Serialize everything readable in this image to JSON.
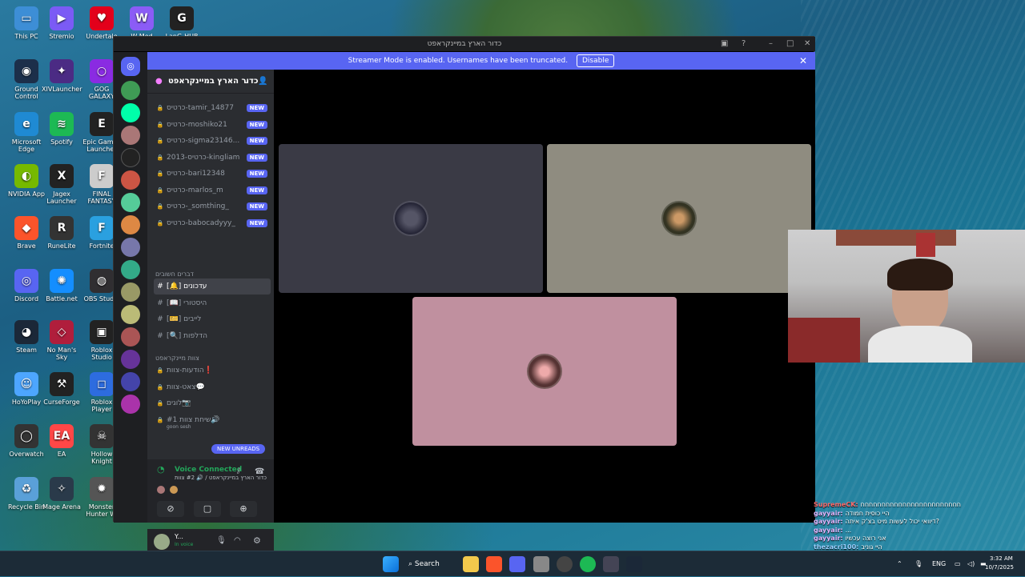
{
  "desktop": {
    "icons": [
      {
        "label": "This PC",
        "color": "#3d8ed6",
        "glyph": "▭"
      },
      {
        "label": "Stremio",
        "color": "#7b5bf5",
        "glyph": "▶"
      },
      {
        "label": "Undertale",
        "color": "#e3001b",
        "glyph": "♥"
      },
      {
        "label": "W-Mod",
        "color": "#8b5cf6",
        "glyph": "W"
      },
      {
        "label": "LanG-HUB",
        "color": "#222",
        "glyph": "G"
      },
      {
        "label": "Ground Control",
        "color": "#1c2f4a",
        "glyph": "◉"
      },
      {
        "label": "XIVLauncher",
        "color": "#4b2b84",
        "glyph": "✦"
      },
      {
        "label": "GOG GALAXY",
        "color": "#8a2be2",
        "glyph": "○"
      },
      {
        "label": "Microsoft Edge",
        "color": "#1f8ad3",
        "glyph": "e"
      },
      {
        "label": "Spotify",
        "color": "#1db954",
        "glyph": "≋"
      },
      {
        "label": "Epic Games Launcher",
        "color": "#222",
        "glyph": "E"
      },
      {
        "label": "NVIDIA App",
        "color": "#76b900",
        "glyph": "◐"
      },
      {
        "label": "Jagex Launcher",
        "color": "#222",
        "glyph": "X"
      },
      {
        "label": "FINAL FANTASY",
        "color": "#ccc",
        "glyph": "F"
      },
      {
        "label": "Brave",
        "color": "#fb542b",
        "glyph": "◆"
      },
      {
        "label": "RuneLite",
        "color": "#333",
        "glyph": "R"
      },
      {
        "label": "Fortnite",
        "color": "#2aa0e0",
        "glyph": "F"
      },
      {
        "label": "Discord",
        "color": "#5865f2",
        "glyph": "◎"
      },
      {
        "label": "Battle.net",
        "color": "#148eff",
        "glyph": "✺"
      },
      {
        "label": "OBS Studio",
        "color": "#302e31",
        "glyph": "◍"
      },
      {
        "label": "Steam",
        "color": "#1b2838",
        "glyph": "◕"
      },
      {
        "label": "No Man's Sky",
        "color": "#b01e3c",
        "glyph": "◇"
      },
      {
        "label": "Roblox Studio",
        "color": "#222",
        "glyph": "▣"
      },
      {
        "label": "HoYoPlay",
        "color": "#4da6ff",
        "glyph": "☺"
      },
      {
        "label": "CurseForge",
        "color": "#222",
        "glyph": "⚒"
      },
      {
        "label": "Roblox Player",
        "color": "#2d6cdf",
        "glyph": "◻"
      },
      {
        "label": "Overwatch",
        "color": "#333",
        "glyph": "◯"
      },
      {
        "label": "EA",
        "color": "#ff4747",
        "glyph": "EA"
      },
      {
        "label": "Hollow Knight",
        "color": "#333",
        "glyph": "☠"
      },
      {
        "label": "Recycle Bin",
        "color": "#5aa0d8",
        "glyph": "♻"
      },
      {
        "label": "Mage Arena",
        "color": "#2a3a4a",
        "glyph": "✧"
      },
      {
        "label": "Monster Hunter W.",
        "color": "#555",
        "glyph": "✹"
      }
    ]
  },
  "window": {
    "title": "כדור הארץ במיינקראפט",
    "help_icon": "help-icon"
  },
  "banner": {
    "text": "Streamer Mode is enabled. Usernames have been truncated.",
    "button": "Disable",
    "close": "✕"
  },
  "server": {
    "name": "כדור הארץ במיינקראפט"
  },
  "channels": [
    {
      "name": "כרטיס-tamir_14877",
      "new": "NEW"
    },
    {
      "name": "כרטיס-moshiko21",
      "new": "NEW"
    },
    {
      "name": "כרטיס-sigma23146...",
      "new": "NEW"
    },
    {
      "name": "2013-כרטיס-kingliam",
      "new": "NEW"
    },
    {
      "name": "כרטיס-bari12348",
      "new": "NEW"
    },
    {
      "name": "כרטיס-marlos_m",
      "new": "NEW"
    },
    {
      "name": "כרטיס-_somthing_",
      "new": "NEW"
    },
    {
      "name": "כרטיס-babocadyyy_",
      "new": "NEW"
    }
  ],
  "cat1": "דברים חשובים",
  "text_channels": [
    {
      "name": "[🔔] עדכונים"
    },
    {
      "name": "[📖] היסטורי"
    },
    {
      "name": "[🎫] לייבים"
    },
    {
      "name": "[🔍] הדלפות"
    }
  ],
  "cat2": "צוות מיינקראפט",
  "staff_channels": [
    {
      "name": "הודעות-צוות❗"
    },
    {
      "name": "צאט-צוות💬"
    },
    {
      "name": "לוגים📷"
    },
    {
      "name": "שיחת צוות #1🔊"
    }
  ],
  "voice_sub": "goon sesh",
  "new_unreads": "NEW UNREADS",
  "voice": {
    "status": "Voice Connected",
    "channel": "כדור הארץ במיינקראפט / 🔊 #2 צוות"
  },
  "user": {
    "name": "Y...",
    "status": "In voice"
  },
  "chat": [
    {
      "user": "SupremeCK:",
      "msg": "חחחחחחחחחחחחחחחחחחחחחחחח",
      "color": "#ff6b6b"
    },
    {
      "user": "gayyair:",
      "msg": "היי כוסית חמודה",
      "color": "#e2b6ff"
    },
    {
      "user": "gayyair:",
      "msg": "דיוואי יכול לעשות מיט בצ'ק איתה?",
      "color": "#e2b6ff"
    },
    {
      "user": "gayyair:",
      "msg": "...",
      "color": "#e2b6ff"
    },
    {
      "user": "gayyair:",
      "msg": "אני רוצה עכשיו",
      "color": "#e2b6ff"
    },
    {
      "user": "thezacri100:",
      "msg": "היי גוניב",
      "color": "#9ad0ff"
    }
  ],
  "taskbar": {
    "search": "Search",
    "lang": "ENG",
    "time": "3:32 AM",
    "date": "10/7/2025"
  }
}
